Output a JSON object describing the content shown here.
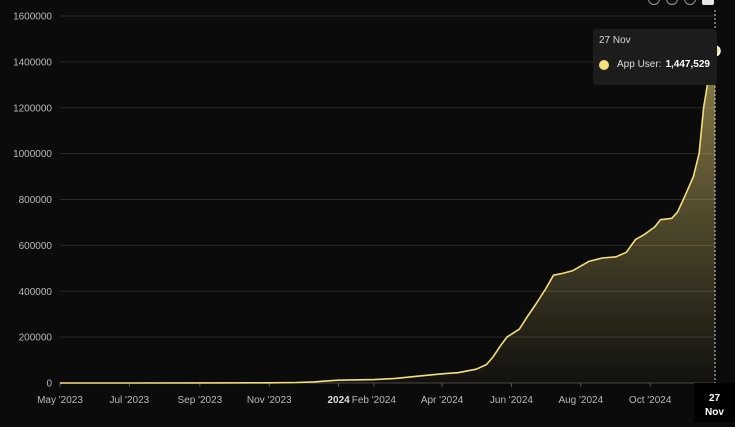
{
  "toolbar": {
    "icons": [
      "info-icon",
      "reset-icon",
      "zoom-icon",
      "home-icon"
    ]
  },
  "colors": {
    "line": "#f5df7a",
    "fill_top": "#f5df7a",
    "grid": "#2a2a2a",
    "text": "#b9b9b9",
    "crosshair": "#cfcfcf"
  },
  "tooltip": {
    "date": "27 Nov",
    "series": "App User:",
    "value": "1,447,529"
  },
  "crosshair_label": {
    "line1": "27",
    "line2": "Nov"
  },
  "chart_data": {
    "type": "area",
    "title": "",
    "xlabel": "",
    "ylabel": "",
    "ylim": [
      0,
      1600000
    ],
    "yticks": [
      0,
      200000,
      400000,
      600000,
      800000,
      1000000,
      1200000,
      1400000,
      1600000
    ],
    "ytick_labels": [
      "0",
      "200000",
      "400000",
      "600000",
      "800000",
      "1000000",
      "1200000",
      "1400000",
      "1600000"
    ],
    "xlim": [
      "2023-05-01",
      "2024-11-27"
    ],
    "xticks": [
      {
        "date": "2023-05-01",
        "label": "May '2023",
        "bold": false
      },
      {
        "date": "2023-07-01",
        "label": "Jul '2023",
        "bold": false
      },
      {
        "date": "2023-09-01",
        "label": "Sep '2023",
        "bold": false
      },
      {
        "date": "2023-11-01",
        "label": "Nov '2023",
        "bold": false
      },
      {
        "date": "2024-01-01",
        "label": "2024",
        "bold": true
      },
      {
        "date": "2024-02-01",
        "label": "Feb '2024",
        "bold": false
      },
      {
        "date": "2024-04-01",
        "label": "Apr '2024",
        "bold": false
      },
      {
        "date": "2024-06-01",
        "label": "Jun '2024",
        "bold": false
      },
      {
        "date": "2024-08-01",
        "label": "Aug '2024",
        "bold": false
      },
      {
        "date": "2024-10-01",
        "label": "Oct '2024",
        "bold": false
      }
    ],
    "grid": true,
    "series": [
      {
        "name": "App User",
        "points": [
          [
            "2023-05-01",
            0
          ],
          [
            "2023-07-01",
            0
          ],
          [
            "2023-09-01",
            500
          ],
          [
            "2023-11-01",
            1000
          ],
          [
            "2023-11-25",
            2000
          ],
          [
            "2023-12-10",
            5000
          ],
          [
            "2023-12-25",
            10000
          ],
          [
            "2024-01-01",
            12000
          ],
          [
            "2024-02-01",
            15000
          ],
          [
            "2024-02-20",
            20000
          ],
          [
            "2024-03-05",
            27000
          ],
          [
            "2024-03-15",
            32000
          ],
          [
            "2024-04-01",
            40000
          ],
          [
            "2024-04-15",
            45000
          ],
          [
            "2024-05-01",
            60000
          ],
          [
            "2024-05-10",
            80000
          ],
          [
            "2024-05-16",
            115000
          ],
          [
            "2024-05-22",
            160000
          ],
          [
            "2024-05-28",
            200000
          ],
          [
            "2024-06-08",
            235000
          ],
          [
            "2024-06-15",
            290000
          ],
          [
            "2024-06-22",
            340000
          ],
          [
            "2024-07-01",
            410000
          ],
          [
            "2024-07-08",
            470000
          ],
          [
            "2024-07-16",
            478000
          ],
          [
            "2024-07-25",
            490000
          ],
          [
            "2024-08-08",
            530000
          ],
          [
            "2024-08-20",
            545000
          ],
          [
            "2024-09-01",
            550000
          ],
          [
            "2024-09-10",
            570000
          ],
          [
            "2024-09-18",
            625000
          ],
          [
            "2024-09-25",
            645000
          ],
          [
            "2024-10-05",
            680000
          ],
          [
            "2024-10-10",
            712000
          ],
          [
            "2024-10-20",
            718000
          ],
          [
            "2024-10-25",
            745000
          ],
          [
            "2024-11-01",
            820000
          ],
          [
            "2024-11-08",
            900000
          ],
          [
            "2024-11-13",
            1000000
          ],
          [
            "2024-11-17",
            1200000
          ],
          [
            "2024-11-22",
            1350000
          ],
          [
            "2024-11-27",
            1447529
          ]
        ]
      }
    ]
  }
}
